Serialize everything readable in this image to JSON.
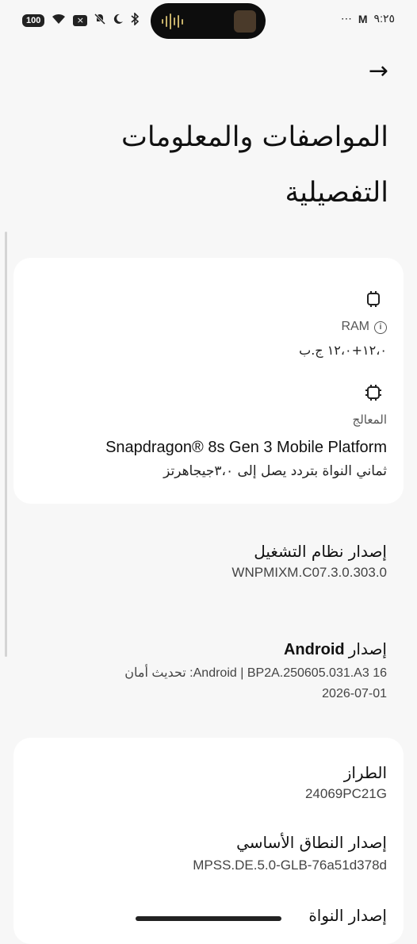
{
  "status_bar": {
    "battery": "100",
    "time": "٩:٢٥",
    "dots": "⋯",
    "mail_glyph": "M"
  },
  "header": {
    "back_arrow": "→",
    "title": "المواصفات والمعلومات التفصيلية"
  },
  "specs_card": {
    "ram": {
      "label": "RAM",
      "value": "١٢،٠+١٢،٠ ج.ب"
    },
    "processor": {
      "label": "المعالج",
      "name": "Snapdragon® 8s Gen 3 Mobile Platform",
      "detail": "ثماني النواة بتردد يصل إلى ٣،٠جيجاهرتز"
    }
  },
  "os_version": {
    "label": "إصدار نظام التشغيل",
    "value": "WNPMIXM.C07.3.0.303.0"
  },
  "android_version": {
    "label_prefix": "إصدار",
    "label_name": "Android",
    "value_line1_ltr": "BP2A.250605.031.A3 16",
    "value_line1_rtl": "تحديث أمان :Android",
    "separator": "|",
    "value_line2": "2026-07-01"
  },
  "details_card": {
    "model": {
      "label": "الطراز",
      "value": "24069PC21G"
    },
    "baseband": {
      "label": "إصدار النطاق الأساسي",
      "value": "MPSS.DE.5.0-GLB-76a51d378d"
    },
    "kernel": {
      "label": "إصدار النواة"
    }
  }
}
